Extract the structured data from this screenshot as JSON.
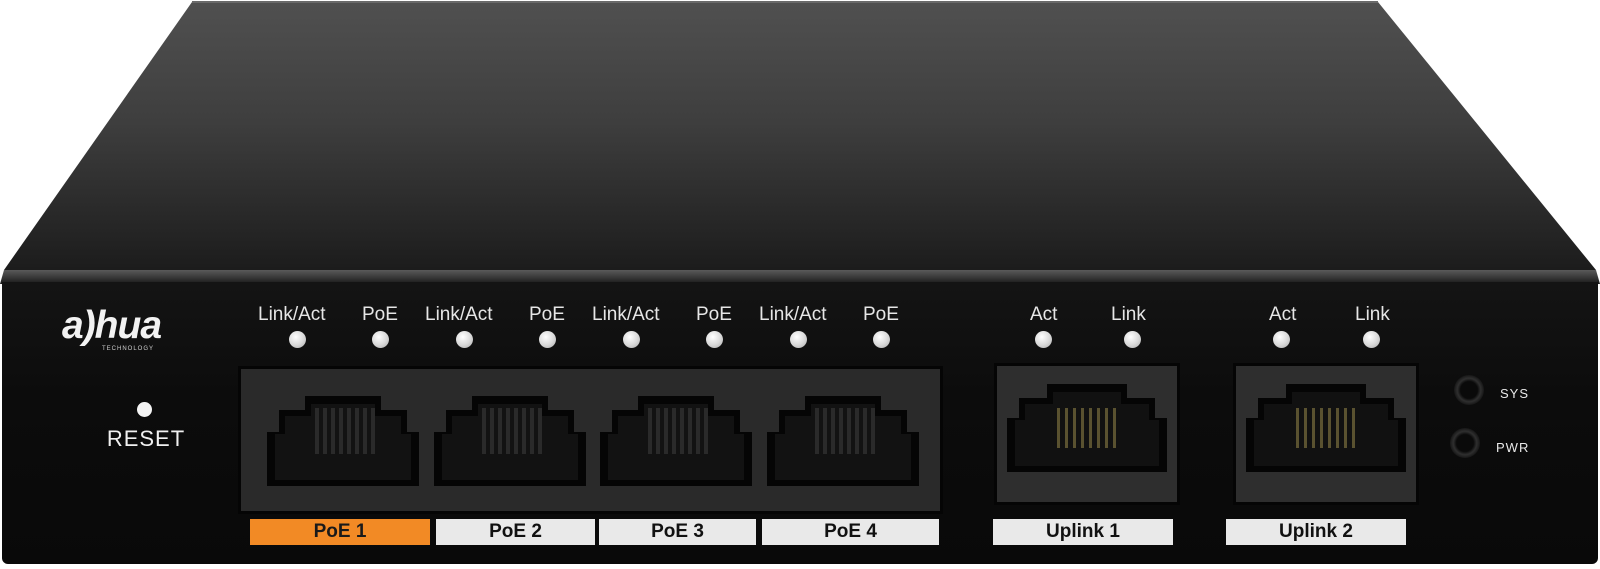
{
  "brand": {
    "logo_text": "a)hua",
    "logo_subtext": "TECHNOLOGY"
  },
  "reset": {
    "label": "RESET"
  },
  "led_groups": [
    {
      "labels": [
        "Link/Act",
        "PoE"
      ]
    },
    {
      "labels": [
        "Link/Act",
        "PoE"
      ]
    },
    {
      "labels": [
        "Link/Act",
        "PoE"
      ]
    },
    {
      "labels": [
        "Link/Act",
        "PoE"
      ]
    },
    {
      "labels": [
        "Act",
        "Link"
      ]
    },
    {
      "labels": [
        "Act",
        "Link"
      ]
    }
  ],
  "ports": [
    {
      "label": "PoE 1",
      "highlight": true
    },
    {
      "label": "PoE 2",
      "highlight": false
    },
    {
      "label": "PoE 3",
      "highlight": false
    },
    {
      "label": "PoE 4",
      "highlight": false
    },
    {
      "label": "Uplink 1",
      "highlight": false
    },
    {
      "label": "Uplink 2",
      "highlight": false
    }
  ],
  "status_indicators": [
    {
      "label": "SYS"
    },
    {
      "label": "PWR"
    }
  ],
  "colors": {
    "chassis": "#111111",
    "poe1_label": "#f28a25",
    "port_label": "#e9e9e9",
    "led": "#e0e0e0"
  }
}
